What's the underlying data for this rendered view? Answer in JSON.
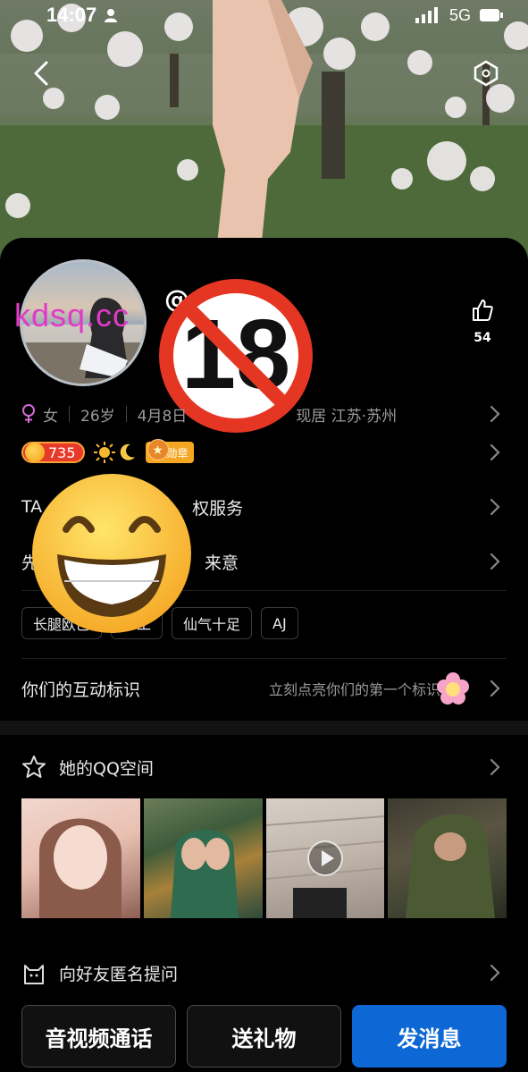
{
  "status_bar": {
    "time": "14:07",
    "network": "5G"
  },
  "profile": {
    "watermark": "kdsq.cc",
    "nick_prefix": "@",
    "likes": "54",
    "gender": "女",
    "age": "26岁",
    "birthday": "4月8日",
    "location_label": "现居 江苏·苏州",
    "level": "735",
    "medal_label": "勋章"
  },
  "rows": {
    "tag_service": "TA的身份特权服务",
    "tag_service_visible": "权服务",
    "intro_prefix": "先",
    "intro_suffix": "来意"
  },
  "tags": [
    "长腿欧巴",
    "手工",
    "仙气十足",
    "AJ"
  ],
  "interaction": {
    "label": "你们的互动标识",
    "hint": "立刻点亮你们的第一个标识"
  },
  "qzone": {
    "label": "她的QQ空间"
  },
  "ask": {
    "label": "向好友匿名提问"
  },
  "actions": {
    "call": "音视频通话",
    "gift": "送礼物",
    "message": "发消息"
  },
  "colors": {
    "primary": "#0d68d6",
    "watermark": "#e03ac8"
  }
}
